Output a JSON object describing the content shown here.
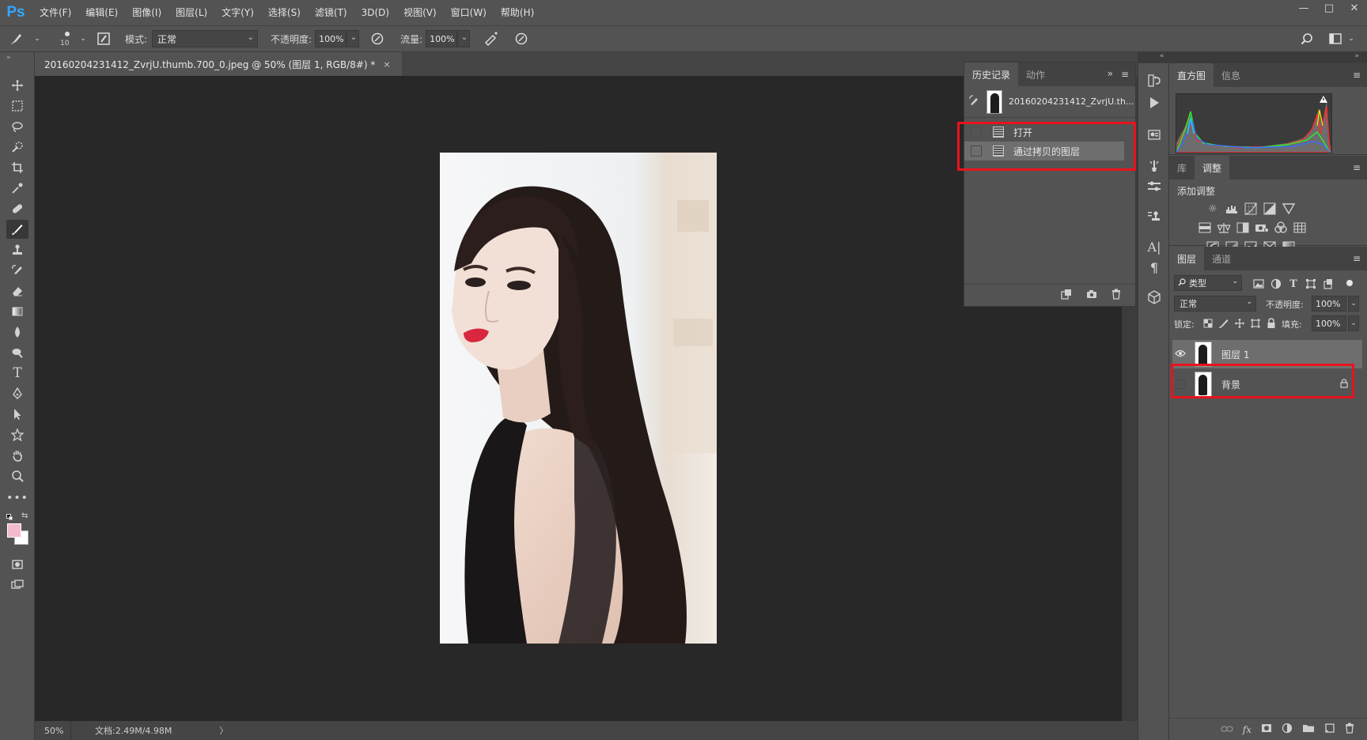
{
  "app": {
    "logo": "Ps"
  },
  "menu": [
    "文件(F)",
    "编辑(E)",
    "图像(I)",
    "图层(L)",
    "文字(Y)",
    "选择(S)",
    "滤镜(T)",
    "3D(D)",
    "视图(V)",
    "窗口(W)",
    "帮助(H)"
  ],
  "window_controls": {
    "minimize": "—",
    "maximize": "□",
    "close": "✕"
  },
  "options": {
    "brush_size": "10",
    "mode_label": "模式:",
    "mode_value": "正常",
    "opacity_label": "不透明度:",
    "opacity_value": "100%",
    "flow_label": "流量:",
    "flow_value": "100%"
  },
  "document": {
    "tab_title": "20160204231412_ZvrjU.thumb.700_0.jpeg @ 50% (图层 1, RGB/8#) *",
    "tab_close": "×",
    "zoom": "50%",
    "doc_info": "文档:2.49M/4.98M",
    "status_arrow": "〉"
  },
  "history_panel": {
    "tabs": [
      "历史记录",
      "动作"
    ],
    "snapshot_name": "20160204231412_ZvrjU.th...",
    "items": [
      "打开",
      "通过拷贝的图层"
    ],
    "highlight_color": "#e8131d"
  },
  "histogram_panel": {
    "tabs": [
      "直方图",
      "信息"
    ]
  },
  "adjustments_panel": {
    "tabs": [
      "库",
      "调整"
    ],
    "title": "添加调整"
  },
  "layers_panel": {
    "tabs": [
      "图层",
      "通道"
    ],
    "filter_kind": "类型",
    "blend_mode": "正常",
    "opacity_label": "不透明度:",
    "opacity_value": "100%",
    "lock_label": "锁定:",
    "fill_label": "填充:",
    "fill_value": "100%",
    "layers": [
      {
        "name": "图层 1",
        "visible": true,
        "selected": true
      },
      {
        "name": "背景",
        "visible": false,
        "selected": false,
        "locked": true
      }
    ]
  },
  "colors": {
    "foreground": "#f4b9cc",
    "background": "#ffffff",
    "ps_blue": "#31a8ff"
  }
}
